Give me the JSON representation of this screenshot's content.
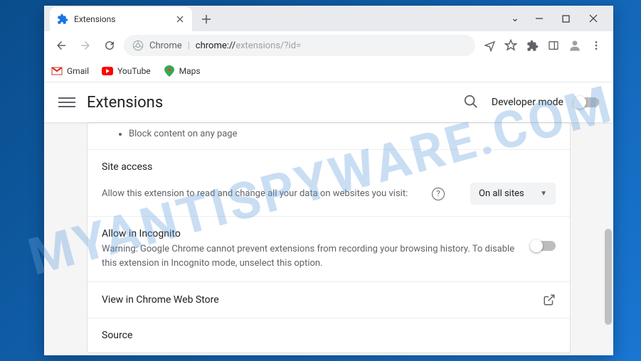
{
  "watermark": "MYANTISPYWARE.COM",
  "tab": {
    "title": "Extensions"
  },
  "addressBar": {
    "prefix": "Chrome",
    "url_label": "chrome://",
    "url_path": "extensions/?id="
  },
  "bookmarks": [
    {
      "label": "Gmail"
    },
    {
      "label": "YouTube"
    },
    {
      "label": "Maps"
    }
  ],
  "header": {
    "title": "Extensions",
    "devMode": "Developer mode"
  },
  "card": {
    "bullet": "Block content on any page",
    "siteAccess": {
      "title": "Site access",
      "label": "Allow this extension to read and change all your data on websites you visit:",
      "dropdown": "On all sites"
    },
    "incognito": {
      "title": "Allow in Incognito",
      "warning": "Warning: Google Chrome cannot prevent extensions from recording your browsing history. To disable this extension in Incognito mode, unselect this option."
    },
    "webStore": "View in Chrome Web Store",
    "source": "Source"
  }
}
